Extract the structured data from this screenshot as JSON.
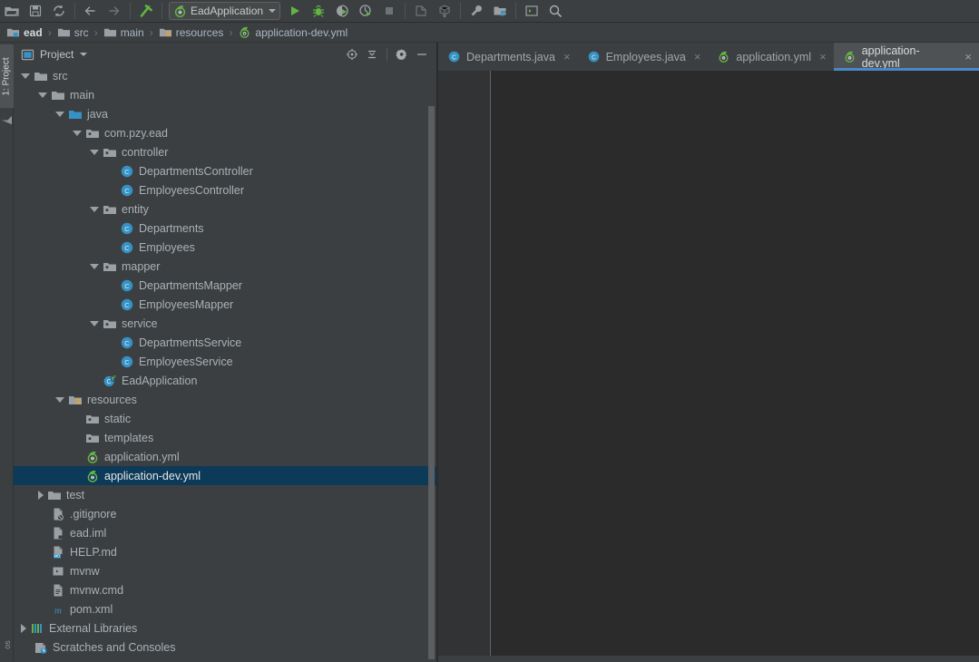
{
  "app": {
    "theme": "darcula",
    "accent": "#4a88c7"
  },
  "toolbar": {
    "buttons": [
      {
        "name": "open-folder-icon",
        "title": "Open"
      },
      {
        "name": "save-all-icon",
        "title": "Save All"
      },
      {
        "name": "sync-refresh-icon",
        "title": "Synchronize"
      },
      {
        "name": "back-arrow-icon",
        "title": "Back"
      },
      {
        "name": "forward-arrow-icon",
        "title": "Forward"
      },
      {
        "name": "build-hammer-icon",
        "title": "Build Project"
      }
    ],
    "run_config": {
      "label": "EadApplication",
      "icon": "spring-boot-icon"
    },
    "run_buttons": [
      {
        "name": "run-icon",
        "title": "Run"
      },
      {
        "name": "debug-icon",
        "title": "Debug"
      },
      {
        "name": "run-with-coverage-icon",
        "title": "Run with Coverage"
      },
      {
        "name": "profiler-icon",
        "title": "Profiler"
      },
      {
        "name": "stop-icon",
        "title": "Stop"
      }
    ],
    "vcs_buttons": [
      {
        "name": "vcs-update-icon",
        "title": "Update Project"
      },
      {
        "name": "vcs-commit-icon",
        "title": "Commit"
      }
    ],
    "right_buttons": [
      {
        "name": "settings-wrench-icon",
        "title": "Settings"
      },
      {
        "name": "project-structure-icon",
        "title": "Project Structure"
      },
      {
        "name": "terminal-icon",
        "title": "Terminal"
      },
      {
        "name": "search-everywhere-icon",
        "title": "Search Everywhere"
      }
    ]
  },
  "breadcrumb": {
    "separator": "›",
    "items": [
      {
        "label": "ead",
        "icon": "module-icon"
      },
      {
        "label": "src",
        "icon": "folder-icon"
      },
      {
        "label": "main",
        "icon": "folder-icon"
      },
      {
        "label": "resources",
        "icon": "resources-folder-icon"
      },
      {
        "label": "application-dev.yml",
        "icon": "spring-yaml-icon"
      }
    ]
  },
  "left_strip": {
    "project_tab": "1: Project",
    "bottom_tab": "os",
    "structure_icon": "structure-icon"
  },
  "project_panel": {
    "title": "Project",
    "view_icon": "project-view-icon",
    "dropdown_icon": "chevron-down-icon",
    "actions": [
      {
        "name": "scroll-from-source-icon",
        "title": "Select Opened File"
      },
      {
        "name": "collapse-all-icon",
        "title": "Collapse All"
      },
      {
        "name": "gear-icon",
        "title": "Settings"
      },
      {
        "name": "hide-icon",
        "title": "Hide"
      }
    ]
  },
  "tree": {
    "selected_index": 19,
    "nodes": [
      {
        "label": "src",
        "depth": 1,
        "arrow": "down",
        "icon": "folder-icon",
        "indent": 0
      },
      {
        "label": "main",
        "depth": 2,
        "arrow": "down",
        "icon": "folder-icon",
        "indent": 0
      },
      {
        "label": "java",
        "depth": 3,
        "arrow": "down",
        "icon": "source-folder-icon",
        "indent": 0
      },
      {
        "label": "com.pzy.ead",
        "depth": 4,
        "arrow": "down",
        "icon": "package-icon",
        "indent": 0
      },
      {
        "label": "controller",
        "depth": 5,
        "arrow": "down",
        "icon": "package-icon",
        "indent": 0
      },
      {
        "label": "DepartmentsController",
        "depth": 6,
        "arrow": "none",
        "icon": "java-class-icon",
        "indent": 0
      },
      {
        "label": "EmployeesController",
        "depth": 6,
        "arrow": "none",
        "icon": "java-class-icon",
        "indent": 0
      },
      {
        "label": "entity",
        "depth": 5,
        "arrow": "down",
        "icon": "package-icon",
        "indent": 0
      },
      {
        "label": "Departments",
        "depth": 6,
        "arrow": "none",
        "icon": "java-class-icon",
        "indent": 0
      },
      {
        "label": "Employees",
        "depth": 6,
        "arrow": "none",
        "icon": "java-class-icon",
        "indent": 0
      },
      {
        "label": "mapper",
        "depth": 5,
        "arrow": "down",
        "icon": "package-icon",
        "indent": 0
      },
      {
        "label": "DepartmentsMapper",
        "depth": 6,
        "arrow": "none",
        "icon": "java-class-icon",
        "indent": 0
      },
      {
        "label": "EmployeesMapper",
        "depth": 6,
        "arrow": "none",
        "icon": "java-class-icon",
        "indent": 0
      },
      {
        "label": "service",
        "depth": 5,
        "arrow": "down",
        "icon": "package-icon",
        "indent": 0
      },
      {
        "label": "DepartmentsService",
        "depth": 6,
        "arrow": "none",
        "icon": "java-class-icon",
        "indent": 0
      },
      {
        "label": "EmployeesService",
        "depth": 6,
        "arrow": "none",
        "icon": "java-class-icon",
        "indent": 0
      },
      {
        "label": "EadApplication",
        "depth": 5,
        "arrow": "none",
        "icon": "spring-class-icon",
        "indent": 0
      },
      {
        "label": "resources",
        "depth": 3,
        "arrow": "down",
        "icon": "resources-folder-icon",
        "indent": 0
      },
      {
        "label": "static",
        "depth": 4,
        "arrow": "none",
        "icon": "package-icon",
        "indent": 0
      },
      {
        "label": "templates",
        "depth": 4,
        "arrow": "none",
        "icon": "package-icon",
        "indent": 0
      },
      {
        "label": "application.yml",
        "depth": 4,
        "arrow": "none",
        "icon": "spring-yaml-icon",
        "indent": 0
      },
      {
        "label": "application-dev.yml",
        "depth": 4,
        "arrow": "none",
        "icon": "spring-yaml-icon",
        "indent": 0,
        "selected": true
      },
      {
        "label": "test",
        "depth": 2,
        "arrow": "right",
        "icon": "folder-icon",
        "indent": 0
      },
      {
        "label": ".gitignore",
        "depth": 2,
        "arrow": "none",
        "icon": "gitignore-file-icon",
        "indent": 0
      },
      {
        "label": "ead.iml",
        "depth": 2,
        "arrow": "none",
        "icon": "iml-file-icon",
        "indent": 0
      },
      {
        "label": "HELP.md",
        "depth": 2,
        "arrow": "none",
        "icon": "markdown-file-icon",
        "indent": 0
      },
      {
        "label": "mvnw",
        "depth": 2,
        "arrow": "none",
        "icon": "script-file-icon",
        "indent": 0
      },
      {
        "label": "mvnw.cmd",
        "depth": 2,
        "arrow": "none",
        "icon": "text-file-icon",
        "indent": 0
      },
      {
        "label": "pom.xml",
        "depth": 2,
        "arrow": "none",
        "icon": "maven-file-icon",
        "indent": 0
      },
      {
        "label": "External Libraries",
        "depth": 1,
        "arrow": "right",
        "icon": "libraries-icon",
        "indent": 0
      },
      {
        "label": "Scratches and Consoles",
        "depth": 1,
        "arrow": "none",
        "icon": "scratches-icon",
        "indent": 0
      }
    ]
  },
  "editor": {
    "tabs": [
      {
        "label": "Departments.java",
        "icon": "java-class-icon",
        "active": false,
        "close": "×"
      },
      {
        "label": "Employees.java",
        "icon": "java-class-icon",
        "active": false,
        "close": "×"
      },
      {
        "label": "application.yml",
        "icon": "spring-yaml-icon",
        "active": false,
        "close": "×"
      },
      {
        "label": "application-dev.yml",
        "icon": "spring-yaml-icon",
        "active": true,
        "close": "×"
      }
    ],
    "content": ""
  }
}
